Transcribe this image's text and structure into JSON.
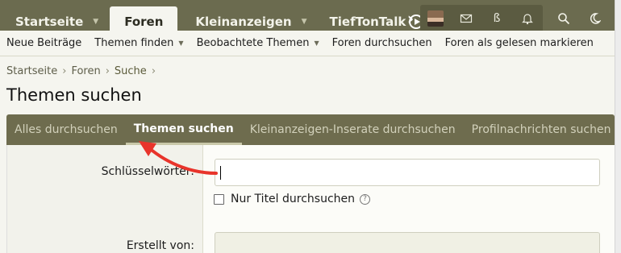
{
  "topnav": {
    "tabs": [
      {
        "label": "Startseite",
        "has_caret": true
      },
      {
        "label": "Foren",
        "active": true
      },
      {
        "label": "Kleinanzeigen",
        "has_caret": true
      },
      {
        "label": "TiefTonTalk"
      }
    ],
    "more_tab": "(",
    "next_arrow": "›",
    "user_initial": "ß"
  },
  "subnav": {
    "items": [
      {
        "label": "Neue Beiträge"
      },
      {
        "label": "Themen finden",
        "has_caret": true
      },
      {
        "label": "Beobachtete Themen",
        "has_caret": true
      },
      {
        "label": "Foren durchsuchen"
      },
      {
        "label": "Foren als gelesen markieren"
      }
    ]
  },
  "breadcrumb": {
    "items": [
      "Startseite",
      "Foren",
      "Suche"
    ],
    "separator": "›"
  },
  "page_title": "Themen suchen",
  "search_tabs": {
    "items": [
      {
        "label": "Alles durchsuchen"
      },
      {
        "label": "Themen suchen",
        "active": true
      },
      {
        "label": "Kleinanzeigen-Inserate durchsuchen"
      },
      {
        "label": "Profilnachrichten suchen"
      }
    ],
    "next": "›"
  },
  "form": {
    "keywords_label": "Schlüsselwörter:",
    "keywords_value": "",
    "title_only_label": "Nur Titel durchsuchen",
    "help_glyph": "?",
    "author_label": "Erstellt von:",
    "author_value": ""
  },
  "colors": {
    "nav_bg": "#6b6b4f",
    "tab_bar_bg": "#6e6c4e",
    "annotation_arrow": "#e8342b"
  }
}
